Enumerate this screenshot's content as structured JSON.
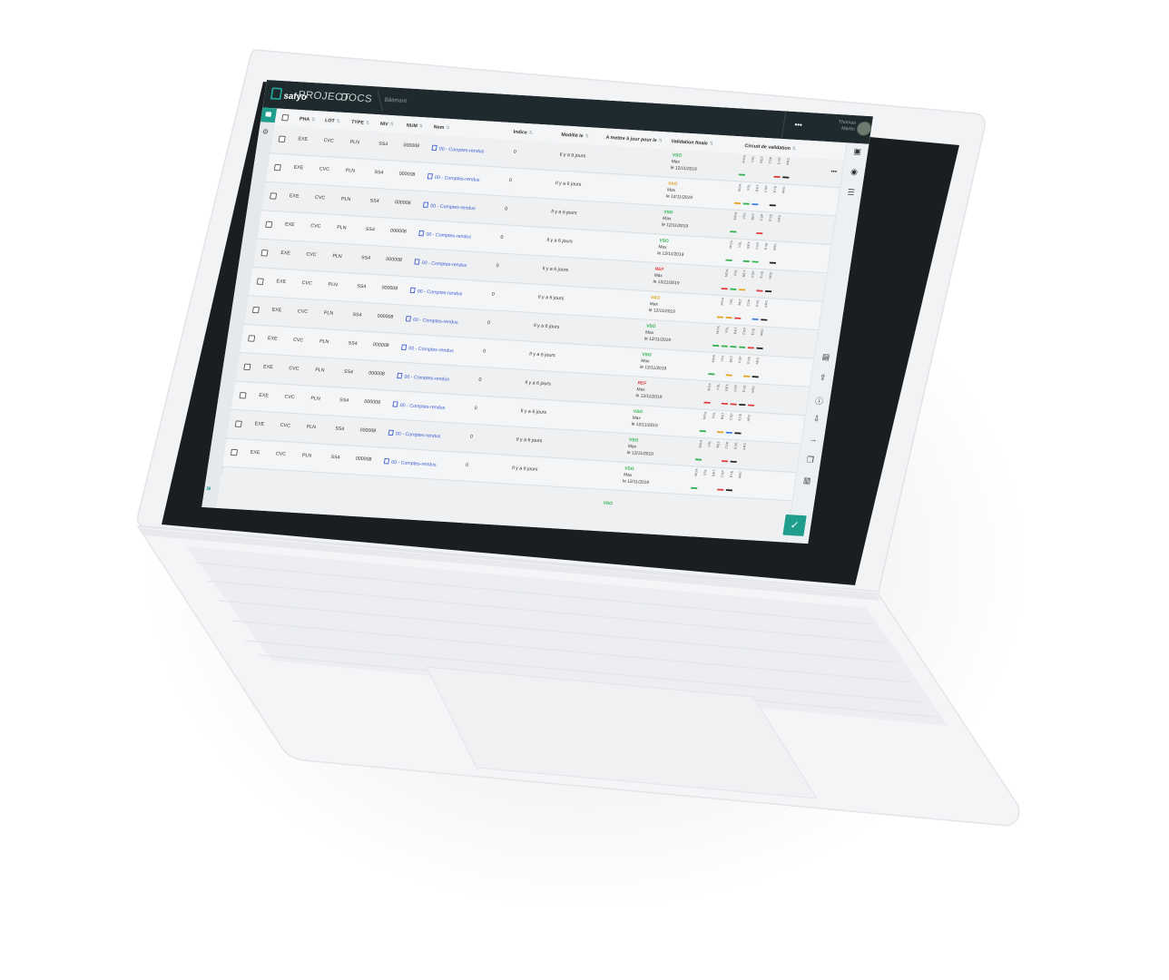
{
  "app": {
    "logo_text": "safyo",
    "breadcrumb": [
      "PROJECT",
      "DOCS"
    ],
    "sub_breadcrumb": "Bâtiment",
    "top_more": "•••",
    "user": {
      "line1": "Thomas",
      "line2": "Martin"
    }
  },
  "colors": {
    "accent": "#1f9e8e",
    "topbar": "#1e2a2e",
    "vso": "#2fb24c",
    "vao": "#e5a21f",
    "ref": "#e03a3a",
    "link": "#3f5fd0"
  },
  "table": {
    "headers": {
      "pha": "PHA",
      "lot": "LOT",
      "type": "TYPE",
      "niv": "NIV",
      "num": "NUM",
      "nom": "Nom",
      "indice": "Indice",
      "modifie": "Modifié le",
      "a_mettre": "A mettre à jour pour le",
      "validation": "Validation finale",
      "circuit": "Circuit de validation",
      "more": "•••"
    },
    "rows": [
      {
        "pha": "EXE",
        "lot": "CVC",
        "type": "PLN",
        "niv": "SS4",
        "num": "000008",
        "nom": "00 - Comptes-rendus",
        "indice": "0",
        "modifie": "Il y a 6 jours",
        "status": "VSO",
        "by": "Max",
        "date": "le 12/11/2019",
        "circuit_bars": [
          "#2fb24c",
          "",
          "",
          "",
          "#e03a3a",
          "#222222"
        ]
      },
      {
        "pha": "EXE",
        "lot": "CVC",
        "type": "PLN",
        "niv": "SS4",
        "num": "000008",
        "nom": "00 - Comptes-rendus",
        "indice": "0",
        "modifie": "Il y a 6 jours",
        "status": "VAO",
        "by": "Max",
        "date": "le 12/11/2019",
        "circuit_bars": [
          "#e5a21f",
          "#2fb24c",
          "#3f7fe0",
          "",
          "#222222",
          ""
        ]
      },
      {
        "pha": "EXE",
        "lot": "CVC",
        "type": "PLN",
        "niv": "SS4",
        "num": "000008",
        "nom": "00 - Comptes-rendus",
        "indice": "0",
        "modifie": "Il y a 6 jours",
        "status": "VSO",
        "by": "Max",
        "date": "le 12/11/2019",
        "circuit_bars": [
          "#2fb24c",
          "",
          "",
          "#e03a3a",
          "",
          ""
        ]
      },
      {
        "pha": "EXE",
        "lot": "CVC",
        "type": "PLN",
        "niv": "SS4",
        "num": "000008",
        "nom": "00 - Comptes-rendus",
        "indice": "0",
        "modifie": "Il y a 6 jours",
        "status": "VSO",
        "by": "Max",
        "date": "le 12/11/2019",
        "circuit_bars": [
          "#2fb24c",
          "",
          "#2fb24c",
          "#2fb24c",
          "",
          "#222222"
        ]
      },
      {
        "pha": "EXE",
        "lot": "CVC",
        "type": "PLN",
        "niv": "SS4",
        "num": "000008",
        "nom": "00 - Comptes-rendus",
        "indice": "0",
        "modifie": "Il y a 6 jours",
        "status": "REF",
        "by": "Max",
        "date": "le 12/11/2019",
        "circuit_bars": [
          "#e03a3a",
          "#2fb24c",
          "#e5a21f",
          "",
          "#e03a3a",
          "#222222"
        ]
      },
      {
        "pha": "EXE",
        "lot": "CVC",
        "type": "PLN",
        "niv": "SS4",
        "num": "000008",
        "nom": "00 - Comptes-rendus",
        "indice": "0",
        "modifie": "Il y a 6 jours",
        "status": "VAO",
        "by": "Max",
        "date": "le 12/11/2019",
        "circuit_bars": [
          "#e5a21f",
          "#e5a21f",
          "#e03a3a",
          "",
          "#3f7fe0",
          "#222222"
        ]
      },
      {
        "pha": "EXE",
        "lot": "CVC",
        "type": "PLN",
        "niv": "SS4",
        "num": "000008",
        "nom": "00 - Comptes-rendus",
        "indice": "0",
        "modifie": "Il y a 6 jours",
        "status": "VSO",
        "by": "Max",
        "date": "le 12/11/2019",
        "circuit_bars": [
          "#2fb24c",
          "#2fb24c",
          "#2fb24c",
          "#2fb24c",
          "#e03a3a",
          "#222222"
        ]
      },
      {
        "pha": "EXE",
        "lot": "CVC",
        "type": "PLN",
        "niv": "SS4",
        "num": "000008",
        "nom": "00 - Comptes-rendus",
        "indice": "0",
        "modifie": "Il y a 6 jours",
        "status": "VSO",
        "by": "Max",
        "date": "le 12/11/2019",
        "circuit_bars": [
          "#2fb24c",
          "",
          "#e5a21f",
          "",
          "#e5a21f",
          "#222222"
        ]
      },
      {
        "pha": "EXE",
        "lot": "CVC",
        "type": "PLN",
        "niv": "SS4",
        "num": "000008",
        "nom": "00 - Comptes-rendus",
        "indice": "0",
        "modifie": "Il y a 6 jours",
        "status": "REF",
        "by": "Max",
        "date": "le 12/11/2019",
        "circuit_bars": [
          "#e03a3a",
          "",
          "#e03a3a",
          "#e03a3a",
          "#222222",
          "#e03a3a"
        ]
      },
      {
        "pha": "EXE",
        "lot": "CVC",
        "type": "PLN",
        "niv": "SS4",
        "num": "000008",
        "nom": "00 - Comptes-rendus",
        "indice": "0",
        "modifie": "Il y a 6 jours",
        "status": "VSO",
        "by": "Max",
        "date": "le 12/11/2019",
        "circuit_bars": [
          "#2fb24c",
          "",
          "#e5a21f",
          "#3f7fe0",
          "#222222",
          ""
        ]
      },
      {
        "pha": "EXE",
        "lot": "CVC",
        "type": "PLN",
        "niv": "SS4",
        "num": "000008",
        "nom": "00 - Comptes-rendus",
        "indice": "0",
        "modifie": "Il y a 6 jours",
        "status": "VSO",
        "by": "Max",
        "date": "le 12/11/2019",
        "circuit_bars": [
          "#2fb24c",
          "",
          "",
          "#e03a3a",
          "#222222",
          ""
        ]
      },
      {
        "pha": "EXE",
        "lot": "CVC",
        "type": "PLN",
        "niv": "SS4",
        "num": "000008",
        "nom": "00 - Comptes-rendus",
        "indice": "0",
        "modifie": "Il y a 6 jours",
        "status": "VSO",
        "by": "Max",
        "date": "le 12/11/2019",
        "circuit_bars": [
          "#2fb24c",
          "",
          "",
          "#e03a3a",
          "#222222",
          ""
        ]
      }
    ],
    "tail_status": "VSO",
    "circuit_labels": [
      "MOA",
      "VSL",
      "BET",
      "CSP",
      "EXE",
      "ARC"
    ]
  },
  "icons": {
    "left": [
      "folder-icon",
      "gear-icon",
      "expand-icon"
    ],
    "right": [
      "save-icon",
      "eye-icon",
      "list-icon",
      "folder-plus-icon",
      "upload-icon",
      "info-icon",
      "download-icon",
      "arrow-right-icon",
      "copy-icon",
      "trash-icon",
      "check-icon"
    ]
  }
}
